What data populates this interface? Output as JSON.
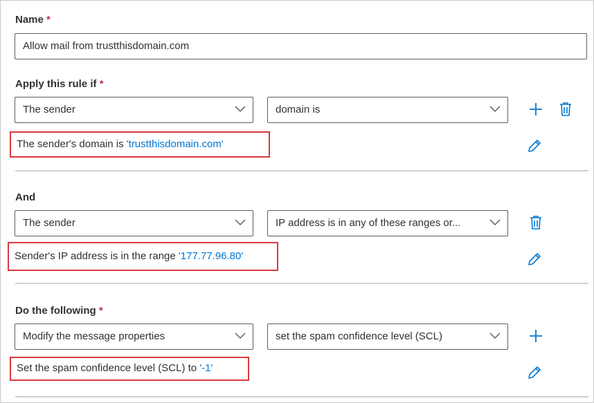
{
  "name_section": {
    "label": "Name",
    "required": "*",
    "value": "Allow mail from trustthisdomain.com"
  },
  "condition": {
    "label": "Apply this rule if",
    "required": "*",
    "dropdown1": "The sender",
    "dropdown2": "domain is",
    "summary_text": "The sender's domain is ",
    "summary_value": "'trustthisdomain.com'"
  },
  "and_condition": {
    "label": "And",
    "dropdown1": "The sender",
    "dropdown2": "IP address is in any of these ranges or...",
    "summary_text": "Sender's IP address is in the range ",
    "summary_value": "'177.77.96.80'"
  },
  "action": {
    "label": "Do the following",
    "required": "*",
    "dropdown1": "Modify the message properties",
    "dropdown2": "set the spam confidence level (SCL)",
    "summary_text": "Set the spam confidence level (SCL) to ",
    "summary_value": "'-1'"
  },
  "icons": {
    "add": "plus-icon",
    "delete": "trash-icon",
    "edit": "pencil-icon",
    "dropdown": "chevron-down-icon"
  },
  "colors": {
    "accent": "#0078d4",
    "required": "#c4314b",
    "highlight_border": "#d9393d"
  }
}
